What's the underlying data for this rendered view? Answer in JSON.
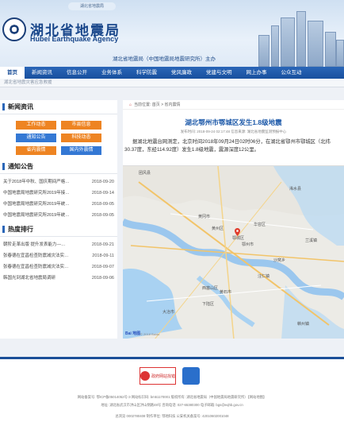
{
  "header": {
    "top_note": "湖北省地震局",
    "title_cn": "湖北省地震局",
    "title_en": "Hubei Earthquake Agency",
    "subtitle": "湖北省地震局（中国地震局地震研究所）主办"
  },
  "nav": {
    "items": [
      "首页",
      "新闻资讯",
      "信息公开",
      "业务体系",
      "科学防震",
      "党风廉政",
      "党建与文明",
      "网上办事",
      "公众互动"
    ]
  },
  "ticker": "湖北省地震灾害应急救援",
  "left": {
    "news": {
      "title": "新闻资讯",
      "buttons": [
        "工作动态",
        "市县信息",
        "通知公告",
        "科技动态",
        "省内震情",
        "国内外震情"
      ]
    },
    "notices": {
      "title": "通知公告",
      "items": [
        {
          "title": "关于2018年中秋、国庆期间严格…",
          "date": "2018-09-20"
        },
        {
          "title": "中国地震局地震研究所2019年接…",
          "date": "2018-09-14"
        },
        {
          "title": "中国地震局地震研究所2019年统…",
          "date": "2018-09-05"
        },
        {
          "title": "中国地震局地震研究所2019年统…",
          "date": "2018-09-05"
        }
      ]
    },
    "hot": {
      "title": "热度排行",
      "items": [
        {
          "title": "朝阶走革出版 提升发表能力—…",
          "date": "2018-09-21"
        },
        {
          "title": "张春德在宜昌检查防震减灾法实…",
          "date": "2018-09-11"
        },
        {
          "title": "张春德在宜昌检查防震减灾法实…",
          "date": "2018-09-07"
        },
        {
          "title": "韩国光到湖北省地震局调研",
          "date": "2018-09-06"
        }
      ]
    }
  },
  "article": {
    "breadcrumb": {
      "home_icon": "home-icon",
      "label": "当前位置: 首页 > 省内震情"
    },
    "title": "湖北鄂州市鄂城区发生1.8级地震",
    "meta": "发布时间: 2018-09-24 02:17:48    信息来源: 湖北省地震监测预报中心",
    "body": "据湖北地震台网测定，北京时间2018年09月24日02时06分，在湖北省鄂州市鄂城区（北纬30.37度，东经114.92度）发生1.8级地震，震源深度12公里。",
    "map": {
      "logo": "Bai 地图",
      "copyright": "© 2018 Baidu",
      "city_labels": [
        "华容区",
        "鄂州市",
        "黄石市",
        "西塞山区",
        "黄冈市",
        "鄂城区",
        "团风县",
        "黄州区",
        "下陆区",
        "浠水县",
        "蕲州镇",
        "大冶市",
        "沙窝乡",
        "兰溪镇",
        "汪仁镇"
      ],
      "marker_color": "#e03b2b"
    }
  },
  "footer": {
    "badge_text": "政府网站找错",
    "lines": [
      "网站备案号: 鄂ICP备05014052号-3  网站标识码: bm51170001  版权所有: 湖北省地震局（中国地震局地震研究所）【网站地图】",
      "地址: 湖北省武汉市洪山区洪山侧路48号  咨询电话: 027-65380300  电子邮箱: bgs@eqhb.gov.cn",
      "总浏览 0002780408  制作单位: 鄂地科技  公安机关备案号: 42010602001048"
    ]
  }
}
